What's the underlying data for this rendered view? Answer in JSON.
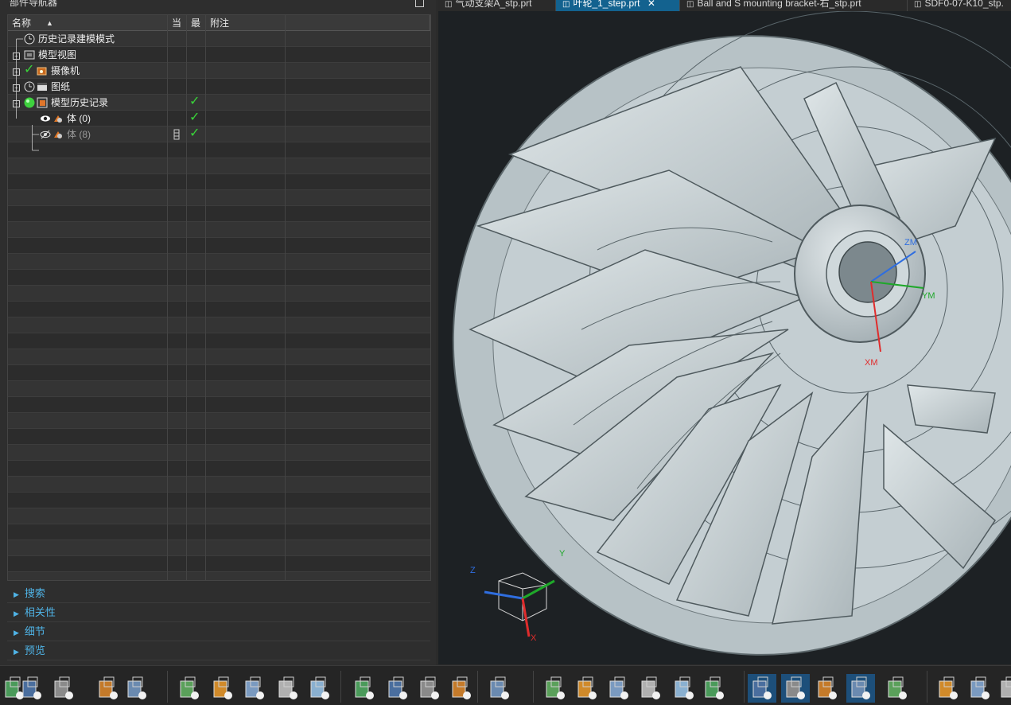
{
  "navigator": {
    "title": "部件导航器",
    "columns": {
      "name": "名称",
      "current": "当",
      "latest": "最",
      "note": "附注"
    },
    "nodes": [
      {
        "label": "历史记录建模模式"
      },
      {
        "label": "模型视图"
      },
      {
        "label": "摄像机"
      },
      {
        "label": "图纸"
      },
      {
        "label": "模型历史记录"
      },
      {
        "label": "体 (0)"
      },
      {
        "label": "体 (8)"
      }
    ],
    "sections": [
      "搜索",
      "相关性",
      "细节",
      "预览"
    ]
  },
  "tabs": [
    {
      "label": "气动支架A_stp.prt"
    },
    {
      "label": "叶轮_1_step.prt"
    },
    {
      "label": "Ball and S mounting bracket-右_stp.prt"
    },
    {
      "label": "SDF0-07-K10_stp."
    }
  ],
  "viewport": {
    "datum_labels": {
      "zm": "ZM",
      "ym": "YM",
      "xm": "XM"
    },
    "triad_labels": {
      "z": "Z",
      "y": "Y",
      "x": "X"
    }
  },
  "colors": {
    "accent": "#4fb3e6",
    "active_tab": "#13628f",
    "check": "#39d539",
    "viewport_bg": "#1d2124",
    "model": "#c9d2d6"
  },
  "toolbar_icons": [
    "create-tool-icon",
    "orient-icon",
    "display-sort-icon",
    "program-icon",
    "display-sort-icon-2",
    "create-tool-icon-2",
    "create-geometry-icon",
    "create-operation-icon",
    "create-method-icon",
    "create-program-icon",
    "feature-icon",
    "cavity-mill-icon",
    "zlevel-icon",
    "contour-icon",
    "operation-list-icon",
    "generate-toolpath-icon",
    "verify-icon",
    "replay-icon",
    "simulate-icon",
    "post-process-icon",
    "shop-docs-icon",
    "program-order-view-icon",
    "machine-tool-view-icon",
    "geometry-view-icon",
    "method-view-icon",
    "tool-icon",
    "up-arrow-icon",
    "layer-icon",
    "down-arrow-icon"
  ]
}
